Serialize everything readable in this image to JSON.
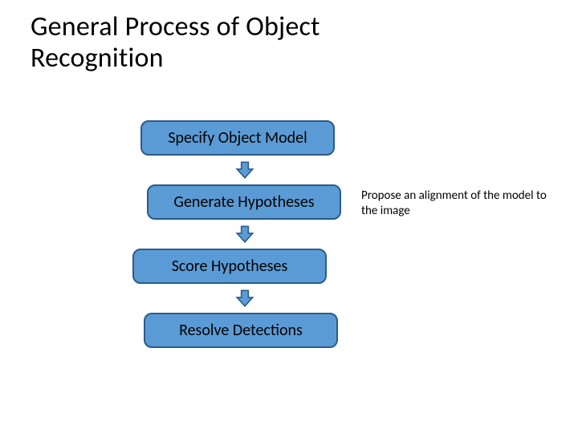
{
  "title_line1": "General Process of Object",
  "title_line2": "Recognition",
  "steps": {
    "s1": "Specify Object Model",
    "s2": "Generate Hypotheses",
    "s3": "Score Hypotheses",
    "s4": "Resolve Detections"
  },
  "annotation": "Propose an alignment of the model to the image",
  "colors": {
    "box_fill": "#5b9bd5",
    "box_border": "#2b5b8a",
    "arrow_fill": "#5b9bd5",
    "arrow_border": "#2b5b8a"
  }
}
